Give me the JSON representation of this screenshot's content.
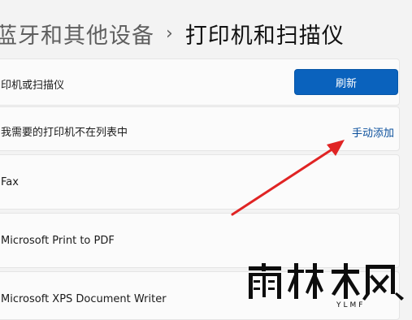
{
  "header": {
    "parent": "蓝牙和其他设备",
    "separator": "›",
    "current": "打印机和扫描仪"
  },
  "add_device": {
    "label": "印机或扫描仪",
    "button_label": "刷新"
  },
  "not_listed": {
    "label": "我需要的打印机不在列表中",
    "link_label": "手动添加"
  },
  "devices": [
    {
      "name": "Fax"
    },
    {
      "name": "Microsoft Print to PDF"
    },
    {
      "name": "Microsoft XPS Document Writer"
    }
  ],
  "watermark": {
    "text": "雨林木风",
    "sub": "YLMF"
  },
  "colors": {
    "accent": "#0a62bd",
    "link": "#0a4f9c",
    "annotation": "#e02424"
  }
}
